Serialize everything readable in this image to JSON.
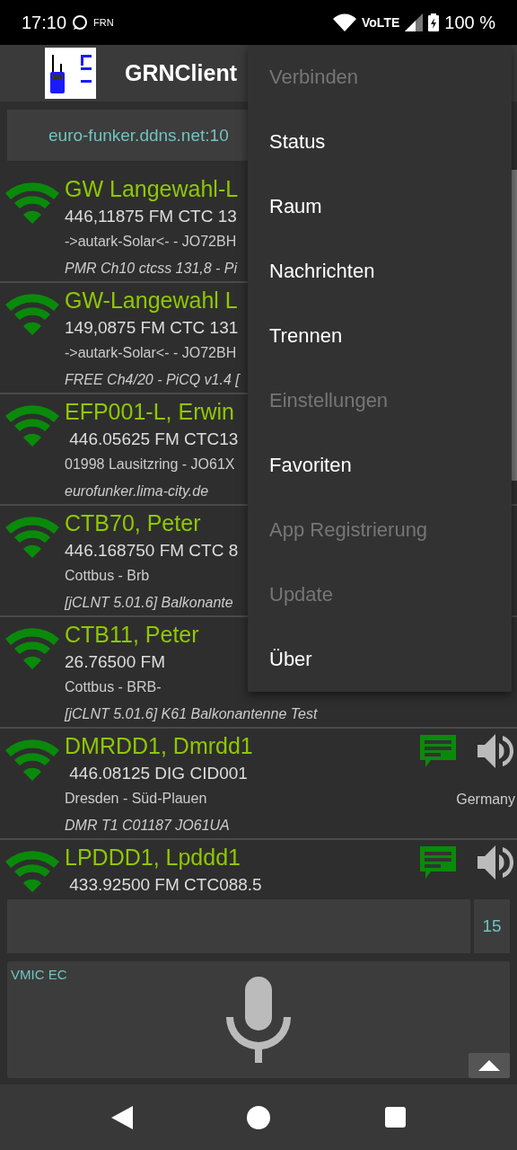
{
  "status_bar": {
    "time": "17:10",
    "app_label": "FRN",
    "network": "VoLTE",
    "battery": "100 %"
  },
  "app_bar": {
    "title": "GRNClient"
  },
  "server": {
    "value": "euro-funker.ddns.net:10"
  },
  "stations": [
    {
      "name": "GW Langewahl-L",
      "frequency": "446,11875 FM CTC 13",
      "location": "->autark-Solar<- - JO72BH",
      "note": "PMR Ch10 ctcss 131,8 - Pi"
    },
    {
      "name": "GW-Langewahl L",
      "frequency": "149,0875 FM CTC 131",
      "location": "->autark-Solar<- - JO72BH",
      "note": "FREE Ch4/20 - PiCQ v1.4 ["
    },
    {
      "name": "EFP001-L, Erwin",
      "frequency": " 446.05625 FM CTC13",
      "location": "01998 Lausitzring - JO61X",
      "note": "eurofunker.lima-city.de"
    },
    {
      "name": "CTB70, Peter",
      "frequency": "446.168750 FM CTC 8",
      "location": "Cottbus - Brb",
      "note": "[jCLNT 5.01.6] Balkonante"
    },
    {
      "name": "CTB11, Peter",
      "frequency": "26.76500 FM",
      "location": "Cottbus - BRB-",
      "note": "[jCLNT 5.01.6] K61 Balkonantenne Test"
    },
    {
      "name": "DMRDD1, Dmrdd1",
      "frequency": " 446.08125 DIG CID001",
      "location": "Dresden - Süd-Plauen",
      "note": "DMR T1 C01187 JO61UA",
      "country": "Germany",
      "message_icon": true
    },
    {
      "name": "LPDDD1, Lpddd1",
      "frequency": " 433.92500 FM CTC088.5",
      "message_icon": true
    }
  ],
  "message_input": {
    "counter": "15"
  },
  "mic_panel": {
    "label": "VMIC EC"
  },
  "menu": [
    {
      "label": "Verbinden",
      "disabled": true
    },
    {
      "label": "Status",
      "disabled": false
    },
    {
      "label": "Raum",
      "disabled": false
    },
    {
      "label": "Nachrichten",
      "disabled": false
    },
    {
      "label": "Trennen",
      "disabled": false
    },
    {
      "label": "Einstellungen",
      "disabled": true
    },
    {
      "label": "Favoriten",
      "disabled": false
    },
    {
      "label": "App Registrierung",
      "disabled": true
    },
    {
      "label": "Update",
      "disabled": true
    },
    {
      "label": "Über",
      "disabled": false
    }
  ]
}
